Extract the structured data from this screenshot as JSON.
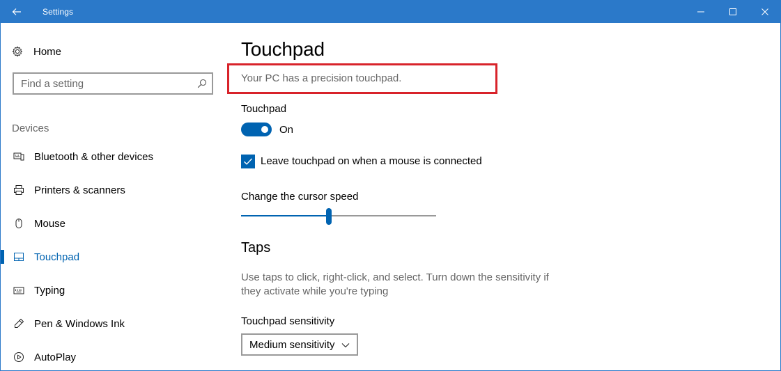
{
  "window": {
    "title": "Settings",
    "accent_color": "#2b79c9",
    "highlight_color": "#d8232a"
  },
  "sidebar": {
    "home_label": "Home",
    "search": {
      "placeholder": "Find a setting"
    },
    "group_label": "Devices",
    "items": [
      {
        "label": "Bluetooth & other devices",
        "icon": "bluetooth-devices-icon",
        "active": false
      },
      {
        "label": "Printers & scanners",
        "icon": "printer-icon",
        "active": false
      },
      {
        "label": "Mouse",
        "icon": "mouse-icon",
        "active": false
      },
      {
        "label": "Touchpad",
        "icon": "touchpad-icon",
        "active": true
      },
      {
        "label": "Typing",
        "icon": "keyboard-icon",
        "active": false
      },
      {
        "label": "Pen & Windows Ink",
        "icon": "pen-icon",
        "active": false
      },
      {
        "label": "AutoPlay",
        "icon": "autoplay-icon",
        "active": false
      }
    ]
  },
  "main": {
    "page_title": "Touchpad",
    "precision_text": "Your PC has a precision touchpad.",
    "touchpad_toggle": {
      "label": "Touchpad",
      "state_text": "On",
      "on": true
    },
    "leave_on_checkbox": {
      "label": "Leave touchpad on when a mouse is connected",
      "checked": true
    },
    "cursor_speed": {
      "label": "Change the cursor speed",
      "value_fraction": 0.45
    },
    "taps": {
      "heading": "Taps",
      "description": "Use taps to click, right-click, and select. Turn down the sensitivity if they activate while you're typing"
    },
    "sensitivity": {
      "label": "Touchpad sensitivity",
      "selected": "Medium sensitivity"
    }
  }
}
